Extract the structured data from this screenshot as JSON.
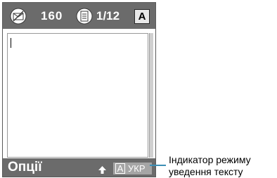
{
  "status_bar": {
    "message_icon": "message-envelope-icon",
    "counter": "160",
    "page_icon": "page-icon",
    "page": "1/12",
    "case_indicator": "A"
  },
  "editor": {
    "text": ""
  },
  "bottom_bar": {
    "left_softkey": "Опції",
    "arrow_icon": "up-arrow-icon",
    "mode_letter": "A",
    "mode_language": "УКР"
  },
  "callout": {
    "line1": "Індикатор режиму",
    "line2": "уведення тексту"
  },
  "colors": {
    "bar_background": "#6b6b6b",
    "mode_background": "#a5a5a5",
    "callout_line": "#3d8fb5"
  }
}
